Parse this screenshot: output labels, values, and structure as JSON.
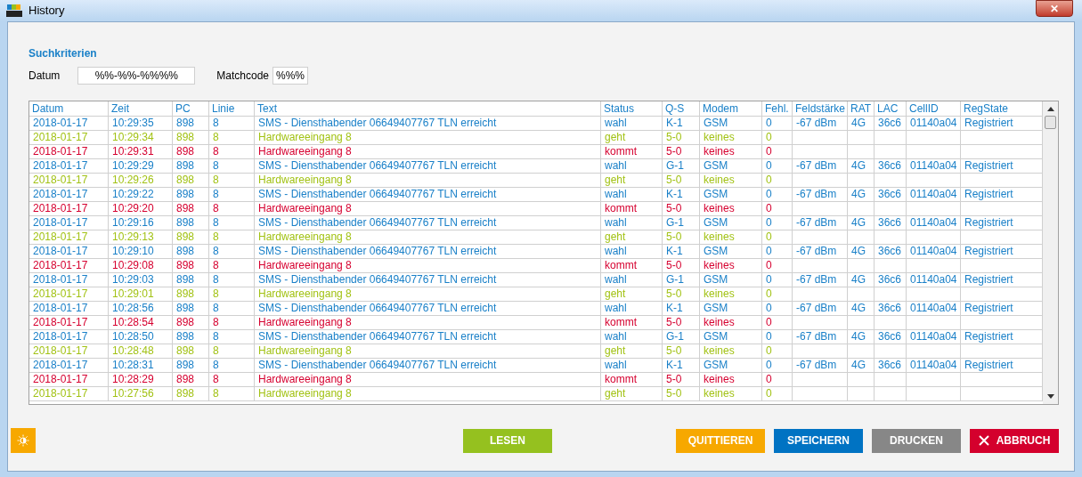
{
  "window": {
    "title": "History",
    "close": "✕"
  },
  "search": {
    "heading": "Suchkriterien",
    "fields": [
      {
        "label": "Datum",
        "value": "%%-%%-%%%%"
      },
      {
        "label": "Matchcode",
        "value": "%%%"
      }
    ]
  },
  "table": {
    "columns": [
      "Datum",
      "Zeit",
      "PC",
      "Linie",
      "Text",
      "Status",
      "Q-S",
      "Modem",
      "Fehl.",
      "Feldstärke",
      "RAT",
      "LAC",
      "CellID",
      "RegState"
    ],
    "rows": [
      {
        "color": "#1a80c8",
        "cells": [
          "2018-01-17",
          "10:29:35",
          "898",
          "8",
          "SMS - Diensthabender 06649407767 TLN erreicht",
          "wahl",
          "K-1",
          "GSM",
          "0",
          "-67 dBm",
          "4G",
          "36c6",
          "01140a04",
          "Registriert"
        ]
      },
      {
        "color": "#a2c214",
        "cells": [
          "2018-01-17",
          "10:29:34",
          "898",
          "8",
          "Hardwareeingang 8",
          "geht",
          "5-0",
          "keines",
          "0"
        ]
      },
      {
        "color": "#d6002f",
        "cells": [
          "2018-01-17",
          "10:29:31",
          "898",
          "8",
          "Hardwareeingang 8",
          "kommt",
          "5-0",
          "keines",
          "0"
        ]
      },
      {
        "color": "#1a80c8",
        "cells": [
          "2018-01-17",
          "10:29:29",
          "898",
          "8",
          "SMS - Diensthabender 06649407767 TLN erreicht",
          "wahl",
          "G-1",
          "GSM",
          "0",
          "-67 dBm",
          "4G",
          "36c6",
          "01140a04",
          "Registriert"
        ]
      },
      {
        "color": "#a2c214",
        "cells": [
          "2018-01-17",
          "10:29:26",
          "898",
          "8",
          "Hardwareeingang 8",
          "geht",
          "5-0",
          "keines",
          "0"
        ]
      },
      {
        "color": "#1a80c8",
        "cells": [
          "2018-01-17",
          "10:29:22",
          "898",
          "8",
          "SMS - Diensthabender 06649407767 TLN erreicht",
          "wahl",
          "K-1",
          "GSM",
          "0",
          "-67 dBm",
          "4G",
          "36c6",
          "01140a04",
          "Registriert"
        ]
      },
      {
        "color": "#d6002f",
        "cells": [
          "2018-01-17",
          "10:29:20",
          "898",
          "8",
          "Hardwareeingang 8",
          "kommt",
          "5-0",
          "keines",
          "0"
        ]
      },
      {
        "color": "#1a80c8",
        "cells": [
          "2018-01-17",
          "10:29:16",
          "898",
          "8",
          "SMS - Diensthabender 06649407767 TLN erreicht",
          "wahl",
          "G-1",
          "GSM",
          "0",
          "-67 dBm",
          "4G",
          "36c6",
          "01140a04",
          "Registriert"
        ]
      },
      {
        "color": "#a2c214",
        "cells": [
          "2018-01-17",
          "10:29:13",
          "898",
          "8",
          "Hardwareeingang 8",
          "geht",
          "5-0",
          "keines",
          "0"
        ]
      },
      {
        "color": "#1a80c8",
        "cells": [
          "2018-01-17",
          "10:29:10",
          "898",
          "8",
          "SMS - Diensthabender 06649407767 TLN erreicht",
          "wahl",
          "K-1",
          "GSM",
          "0",
          "-67 dBm",
          "4G",
          "36c6",
          "01140a04",
          "Registriert"
        ]
      },
      {
        "color": "#d6002f",
        "cells": [
          "2018-01-17",
          "10:29:08",
          "898",
          "8",
          "Hardwareeingang 8",
          "kommt",
          "5-0",
          "keines",
          "0"
        ]
      },
      {
        "color": "#1a80c8",
        "cells": [
          "2018-01-17",
          "10:29:03",
          "898",
          "8",
          "SMS - Diensthabender 06649407767 TLN erreicht",
          "wahl",
          "G-1",
          "GSM",
          "0",
          "-67 dBm",
          "4G",
          "36c6",
          "01140a04",
          "Registriert"
        ]
      },
      {
        "color": "#a2c214",
        "cells": [
          "2018-01-17",
          "10:29:01",
          "898",
          "8",
          "Hardwareeingang 8",
          "geht",
          "5-0",
          "keines",
          "0"
        ]
      },
      {
        "color": "#1a80c8",
        "cells": [
          "2018-01-17",
          "10:28:56",
          "898",
          "8",
          "SMS - Diensthabender 06649407767 TLN erreicht",
          "wahl",
          "K-1",
          "GSM",
          "0",
          "-67 dBm",
          "4G",
          "36c6",
          "01140a04",
          "Registriert"
        ]
      },
      {
        "color": "#d6002f",
        "cells": [
          "2018-01-17",
          "10:28:54",
          "898",
          "8",
          "Hardwareeingang 8",
          "kommt",
          "5-0",
          "keines",
          "0"
        ]
      },
      {
        "color": "#1a80c8",
        "cells": [
          "2018-01-17",
          "10:28:50",
          "898",
          "8",
          "SMS - Diensthabender 06649407767 TLN erreicht",
          "wahl",
          "G-1",
          "GSM",
          "0",
          "-67 dBm",
          "4G",
          "36c6",
          "01140a04",
          "Registriert"
        ]
      },
      {
        "color": "#a2c214",
        "cells": [
          "2018-01-17",
          "10:28:48",
          "898",
          "8",
          "Hardwareeingang 8",
          "geht",
          "5-0",
          "keines",
          "0"
        ]
      },
      {
        "color": "#1a80c8",
        "cells": [
          "2018-01-17",
          "10:28:31",
          "898",
          "8",
          "SMS - Diensthabender 06649407767 TLN erreicht",
          "wahl",
          "K-1",
          "GSM",
          "0",
          "-67 dBm",
          "4G",
          "36c6",
          "01140a04",
          "Registriert"
        ]
      },
      {
        "color": "#d6002f",
        "cells": [
          "2018-01-17",
          "10:28:29",
          "898",
          "8",
          "Hardwareeingang 8",
          "kommt",
          "5-0",
          "keines",
          "0"
        ]
      },
      {
        "color": "#a2c214",
        "cells": [
          "2018-01-17",
          "10:27:56",
          "898",
          "8",
          "Hardwareeingang 8",
          "geht",
          "5-0",
          "keines",
          "0"
        ]
      }
    ]
  },
  "buttons": [
    {
      "kind": "icon"
    },
    {
      "kind": "read",
      "label": "LESEN"
    },
    {
      "kind": "ack",
      "label": "QUITTIEREN"
    },
    {
      "kind": "save",
      "label": "SPEICHERN"
    },
    {
      "kind": "print",
      "label": "DRUCKEN"
    },
    {
      "kind": "cancel",
      "label": "ABBRUCH"
    }
  ]
}
